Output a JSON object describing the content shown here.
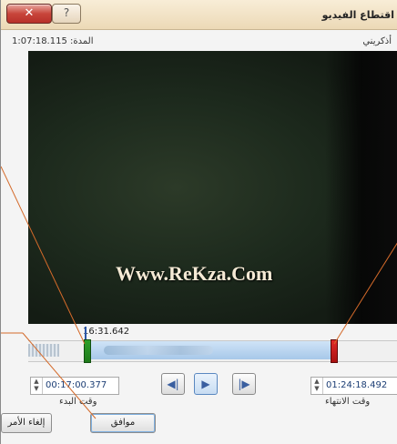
{
  "dialog": {
    "title": "اقتطاع الفيديو",
    "close_glyph": "✕",
    "help_glyph": "?"
  },
  "info": {
    "duration": "المدة: 1:07:18.115",
    "file_name": "أذكريني"
  },
  "video": {
    "watermark": "Www.ReKza.Com"
  },
  "timeline": {
    "current_time": "16:31.642",
    "start_marker_fraction": 0.15,
    "end_marker_fraction": 0.82
  },
  "trim": {
    "start_value": "00:17:00.377",
    "start_label": "وقت البدء",
    "end_value": "01:24:18.492",
    "end_label": "وقت الانتهاء",
    "spin_up": "▲",
    "spin_down": "▼"
  },
  "playback": {
    "prev_glyph": "◀|",
    "play_glyph": "▶",
    "next_glyph": "|▶"
  },
  "buttons": {
    "ok": "موافق",
    "cancel": "إلغاء الأمر"
  },
  "colors": {
    "accent": "#3a5fa0",
    "start_marker": "#2ea02a",
    "end_marker": "#e02a2a",
    "leader_line": "#d46a2a"
  }
}
